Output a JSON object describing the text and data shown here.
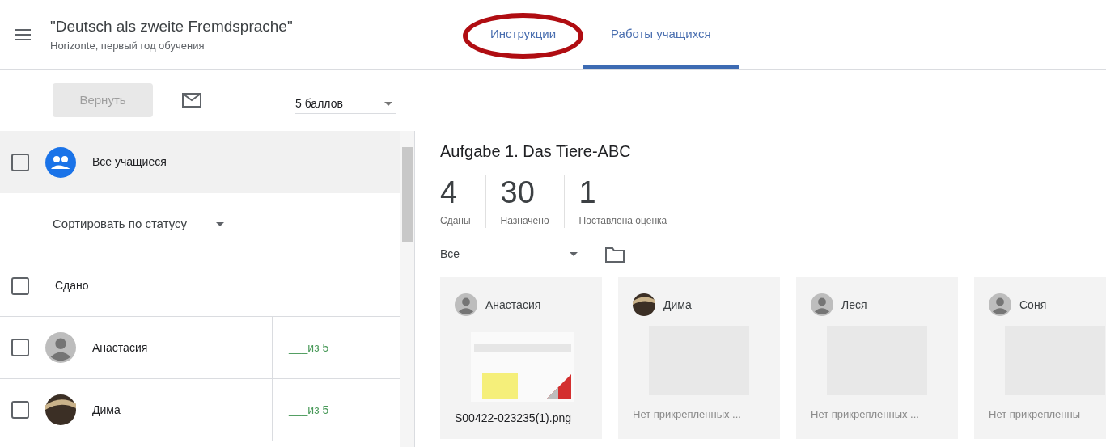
{
  "header": {
    "title": "\"Deutsch als zweite Fremdsprache\"",
    "subtitle": "Horizonte, первый год обучения"
  },
  "tabs": [
    {
      "label": "Инструкции",
      "selected": false,
      "highlighted": true
    },
    {
      "label": "Работы учащихся",
      "selected": true,
      "highlighted": false
    }
  ],
  "toolbar": {
    "return_button": {
      "label": "Вернуть",
      "disabled": true
    },
    "points": "5 баллов"
  },
  "sidebar": {
    "all_students": {
      "label": "Все учащиеся",
      "checked": false
    },
    "sort": "Сортировать по статусу",
    "group": {
      "label": "Сдано",
      "checked": false
    },
    "students": [
      {
        "name": "Анастасия",
        "grade": "___из 5",
        "checked": false,
        "photo": false
      },
      {
        "name": "Дима",
        "grade": "___из 5",
        "checked": false,
        "photo": true
      }
    ]
  },
  "assignment": {
    "title": "Aufgabe 1. Das Tiere-ABC",
    "stats": [
      {
        "value": "4",
        "label": "Сданы"
      },
      {
        "value": "30",
        "label": "Назначено"
      },
      {
        "value": "1",
        "label": "Поставлена оценка"
      }
    ],
    "filter": "Все",
    "cards": [
      {
        "name": "Анастасия",
        "photo": false,
        "kind": "file",
        "caption": "S00422-023235(1).png"
      },
      {
        "name": "Дима",
        "photo": true,
        "kind": "empty",
        "caption": "Нет прикрепленных ..."
      },
      {
        "name": "Леся",
        "photo": false,
        "kind": "empty",
        "caption": "Нет прикрепленных ..."
      },
      {
        "name": "Соня",
        "photo": false,
        "kind": "empty",
        "caption": "Нет прикрепленны"
      }
    ]
  }
}
